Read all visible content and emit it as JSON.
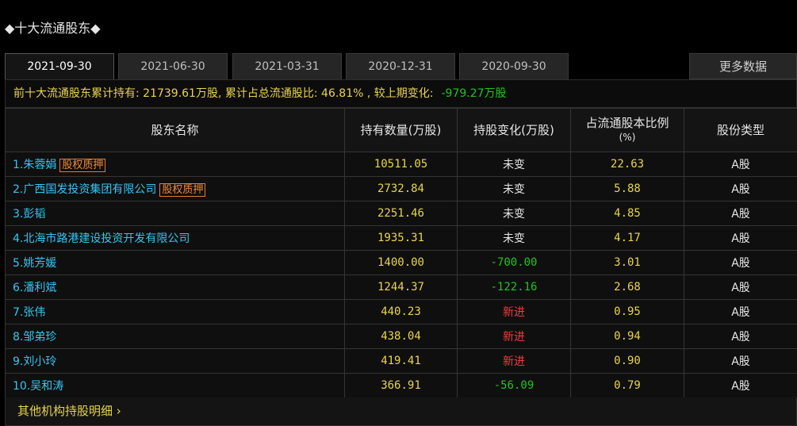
{
  "page_title": "◆十大流通股东◆",
  "tabs": [
    {
      "label": "2021-09-30",
      "active": true
    },
    {
      "label": "2021-06-30",
      "active": false
    },
    {
      "label": "2021-03-31",
      "active": false
    },
    {
      "label": "2020-12-31",
      "active": false
    },
    {
      "label": "2020-09-30",
      "active": false
    }
  ],
  "more_label": "更多数据",
  "summary": {
    "text": "前十大流通股东累计持有: 21739.61万股, 累计占总流通股比: 46.81% , 较上期变化:",
    "change": "-979.27万股"
  },
  "table": {
    "headers": {
      "name": "股东名称",
      "hold": "持有数量(万股)",
      "change": "持股变化(万股)",
      "ratio_line1": "占流通股本比例",
      "ratio_line2": "(%)",
      "type": "股份类型"
    },
    "rows": [
      {
        "name": "1.朱蓉娟",
        "badge": "股权质押",
        "hold": "10511.05",
        "change": "未变",
        "change_kind": "same",
        "ratio": "22.63",
        "type": "A股"
      },
      {
        "name": "2.广西国发投资集团有限公司",
        "badge": "股权质押",
        "hold": "2732.84",
        "change": "未变",
        "change_kind": "same",
        "ratio": "5.88",
        "type": "A股"
      },
      {
        "name": "3.彭韬",
        "badge": "",
        "hold": "2251.46",
        "change": "未变",
        "change_kind": "same",
        "ratio": "4.85",
        "type": "A股"
      },
      {
        "name": "4.北海市路港建设投资开发有限公司",
        "badge": "",
        "hold": "1935.31",
        "change": "未变",
        "change_kind": "same",
        "ratio": "4.17",
        "type": "A股"
      },
      {
        "name": "5.姚芳媛",
        "badge": "",
        "hold": "1400.00",
        "change": "-700.00",
        "change_kind": "neg",
        "ratio": "3.01",
        "type": "A股"
      },
      {
        "name": "6.潘利斌",
        "badge": "",
        "hold": "1244.37",
        "change": "-122.16",
        "change_kind": "neg",
        "ratio": "2.68",
        "type": "A股"
      },
      {
        "name": "7.张伟",
        "badge": "",
        "hold": "440.23",
        "change": "新进",
        "change_kind": "new",
        "ratio": "0.95",
        "type": "A股"
      },
      {
        "name": "8.邹弟珍",
        "badge": "",
        "hold": "438.04",
        "change": "新进",
        "change_kind": "new",
        "ratio": "0.94",
        "type": "A股"
      },
      {
        "name": "9.刘小玲",
        "badge": "",
        "hold": "419.41",
        "change": "新进",
        "change_kind": "new",
        "ratio": "0.90",
        "type": "A股"
      },
      {
        "name": "10.吴和涛",
        "badge": "",
        "hold": "366.91",
        "change": "-56.09",
        "change_kind": "neg",
        "ratio": "0.79",
        "type": "A股"
      }
    ]
  },
  "footer_link": "其他机构持股明细 ›",
  "colors": {
    "name_blue": "#33c6f0",
    "value_yellow": "#e8d44d",
    "negative_green": "#1fc41f",
    "new_red": "#f03c3c",
    "badge_orange": "#f08a3a"
  }
}
